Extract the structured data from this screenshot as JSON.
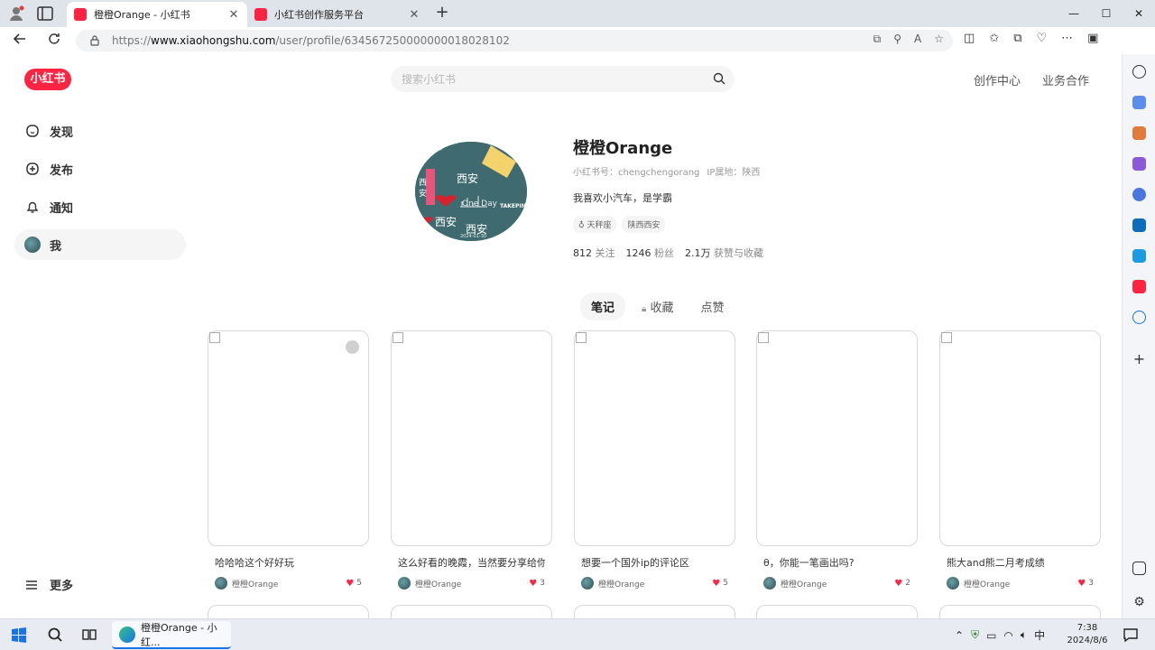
{
  "browser": {
    "tabs": [
      {
        "title": "橙橙Orange - 小红书",
        "active": true
      },
      {
        "title": "小红书创作服务平台",
        "active": false
      }
    ],
    "new_tab_symbol": "+",
    "window_controls": {
      "minimize": "—",
      "maximize": "☐",
      "close": "✕"
    },
    "url": {
      "scheme": "https://",
      "host": "www.xiaohongshu.com",
      "path": "/user/profile/634567250000000018028102"
    }
  },
  "site": {
    "logo": "小红书",
    "search_placeholder": "搜索小红书",
    "top_links": [
      "创作中心",
      "业务合作"
    ]
  },
  "nav": {
    "items": [
      {
        "label": "发现",
        "icon": "home-icon"
      },
      {
        "label": "发布",
        "icon": "plus-square-icon"
      },
      {
        "label": "通知",
        "icon": "bell-icon"
      },
      {
        "label": "我",
        "icon": "avatar"
      }
    ],
    "more": "更多"
  },
  "profile": {
    "name": "橙橙Orange",
    "id_label": "小红书号：chengchengorang",
    "ip_label": "IP属地：陕西",
    "bio": "我喜欢小汽车，是学霸",
    "tags": [
      "♁ 天秤座",
      "陕西西安"
    ],
    "stats": [
      {
        "value": "812",
        "label": "关注"
      },
      {
        "value": "1246",
        "label": "粉丝"
      },
      {
        "value": "2.1万",
        "label": "获赞与收藏"
      }
    ],
    "avatar_text": {
      "a": "西安",
      "b": "西安",
      "c": "西安",
      "d": "One Day",
      "e": "[这里]",
      "f": "TAKEPIN",
      "g": "西\n安",
      "h": "2024-01-30"
    }
  },
  "tabs": [
    {
      "label": "笔记",
      "active": true
    },
    {
      "label": "收藏",
      "active": false,
      "locked": true
    },
    {
      "label": "点赞",
      "active": false
    }
  ],
  "notes": [
    {
      "title": "哈哈哈这个好好玩",
      "author": "橙橙Orange",
      "likes": "5",
      "video": true
    },
    {
      "title": "这么好看的晚霞，当然要分享给你",
      "author": "橙橙Orange",
      "likes": "3",
      "video": false
    },
    {
      "title": "想要一个国外ip的评论区",
      "author": "橙橙Orange",
      "likes": "5",
      "video": false
    },
    {
      "title": "θ，你能一笔画出吗?",
      "author": "橙橙Orange",
      "likes": "2",
      "video": false
    },
    {
      "title": "熊大and熊二月考成绩",
      "author": "橙橙Orange",
      "likes": "3",
      "video": false
    }
  ],
  "taskbar": {
    "app_title": "橙橙Orange - 小红...",
    "ime": "中",
    "time": "7:38",
    "date": "2024/8/6"
  },
  "colors": {
    "brand": "#ff2442",
    "edge_accent": "#1a73e8"
  }
}
